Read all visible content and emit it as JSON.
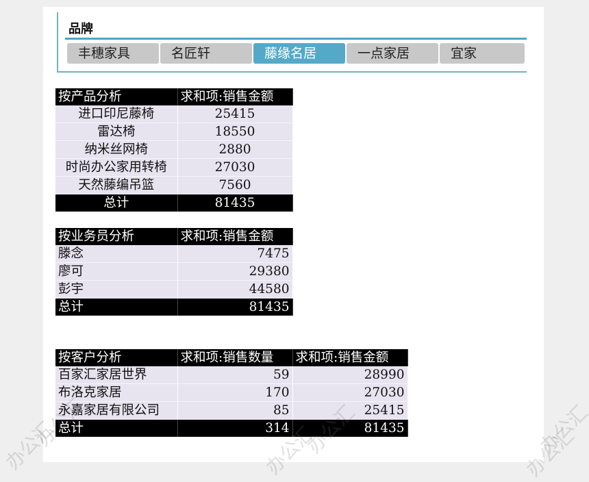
{
  "slicer": {
    "title": "品牌",
    "items": [
      {
        "label": "丰穗家具",
        "selected": false
      },
      {
        "label": "名匠轩",
        "selected": false
      },
      {
        "label": "藤缘名居",
        "selected": true
      },
      {
        "label": "一点家居",
        "selected": false
      },
      {
        "label": "宜家",
        "selected": false
      }
    ],
    "accent_color": "#4da6c3",
    "selected_color": "#55a9c8"
  },
  "table_product": {
    "headers": [
      "按产品分析",
      "求和项:销售金额"
    ],
    "rows": [
      {
        "name": "进口印尼藤椅",
        "amount": "25415"
      },
      {
        "name": "雷达椅",
        "amount": "18550"
      },
      {
        "name": "纳米丝网椅",
        "amount": "2880"
      },
      {
        "name": "时尚办公家用转椅",
        "amount": "27030"
      },
      {
        "name": "天然藤编吊篮",
        "amount": "7560"
      }
    ],
    "total": {
      "label": "总计",
      "amount": "81435"
    }
  },
  "table_salesperson": {
    "headers": [
      "按业务员分析",
      "求和项:销售金额"
    ],
    "rows": [
      {
        "name": "滕念",
        "amount": "7475"
      },
      {
        "name": "廖可",
        "amount": "29380"
      },
      {
        "name": "彭宇",
        "amount": "44580"
      }
    ],
    "total": {
      "label": "总计",
      "amount": "81435"
    }
  },
  "table_customer": {
    "headers": [
      "按客户分析",
      "求和项:销售数量",
      "求和项:销售金额"
    ],
    "rows": [
      {
        "name": "百家汇家居世界",
        "qty": "59",
        "amount": "28990"
      },
      {
        "name": "布洛克家居",
        "qty": "170",
        "amount": "27030"
      },
      {
        "name": "永嘉家居有限公司",
        "qty": "85",
        "amount": "25415"
      }
    ],
    "total": {
      "label": "总计",
      "qty": "314",
      "amount": "81435"
    }
  },
  "watermark": "办公汇"
}
